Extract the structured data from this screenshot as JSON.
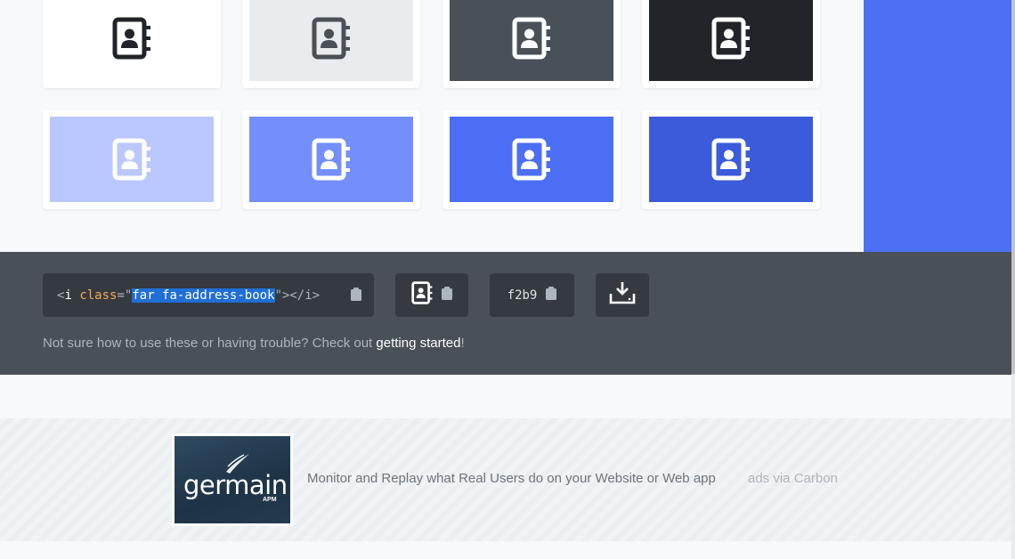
{
  "icon_name": "address-book-icon",
  "swatches": [
    {
      "bg": "#ffffff",
      "icon": "#212529"
    },
    {
      "bg": "#e9ecef",
      "icon": "#495057"
    },
    {
      "bg": "#495057",
      "icon": "#ffffff"
    },
    {
      "bg": "#212529",
      "icon": "#ffffff"
    },
    {
      "bg": "#bac8ff",
      "icon": "#ffffff"
    },
    {
      "bg": "#748ffc",
      "icon": "#ffffff"
    },
    {
      "bg": "#4c6ef5",
      "icon": "#ffffff"
    },
    {
      "bg": "#3b5bdb",
      "icon": "#ffffff"
    }
  ],
  "accent_panel_color": "#4d6ff3",
  "code": {
    "open": "<",
    "tag": "i",
    "attr": "class",
    "eq": "=",
    "quote": "\"",
    "value": "far fa-address-book",
    "close": "\"></i>"
  },
  "unicode": "f2b9",
  "help": {
    "text": "Not sure how to use these or having trouble? Check out ",
    "link": "getting started",
    "suffix": "!"
  },
  "ad": {
    "logo_text": "germain",
    "logo_sub": "APM",
    "text": "Monitor and Replay what Real Users do on your Website or Web app",
    "via": "ads via Carbon"
  }
}
